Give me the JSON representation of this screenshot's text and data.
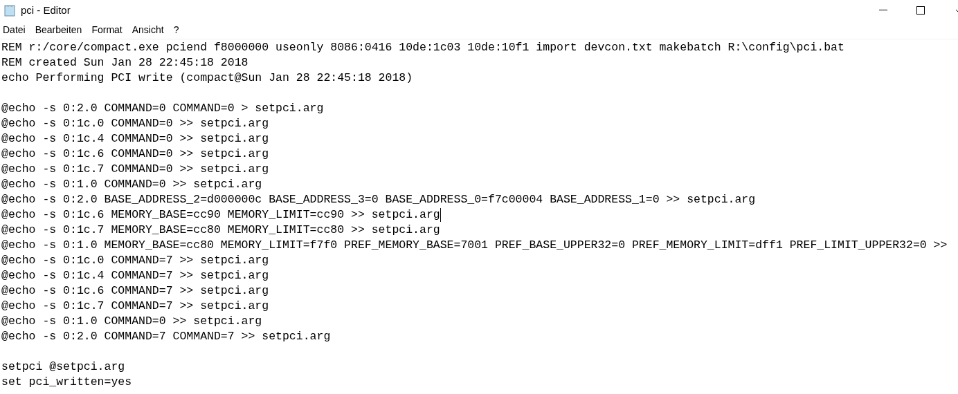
{
  "window": {
    "title": "pci - Editor"
  },
  "menu": [
    "Datei",
    "Bearbeiten",
    "Format",
    "Ansicht",
    "?"
  ],
  "lines": [
    {
      "kind": "text",
      "text": "REM r:/core/compact.exe pciend f8000000 useonly 8086:0416 10de:1c03 10de:10f1 import devcon.txt makebatch R:\\config\\pci.bat",
      "caret": false
    },
    {
      "kind": "text",
      "text": "REM created Sun Jan 28 22:45:18 2018",
      "caret": false
    },
    {
      "kind": "text",
      "text": "echo Performing PCI write (compact@Sun Jan 28 22:45:18 2018)",
      "caret": false
    },
    {
      "kind": "blank",
      "caret": false
    },
    {
      "kind": "text",
      "text": "@echo -s 0:2.0 COMMAND=0 COMMAND=0 > setpci.arg",
      "caret": false
    },
    {
      "kind": "text",
      "text": "@echo -s 0:1c.0 COMMAND=0 >> setpci.arg",
      "caret": false
    },
    {
      "kind": "text",
      "text": "@echo -s 0:1c.4 COMMAND=0 >> setpci.arg",
      "caret": false
    },
    {
      "kind": "text",
      "text": "@echo -s 0:1c.6 COMMAND=0 >> setpci.arg",
      "caret": false
    },
    {
      "kind": "text",
      "text": "@echo -s 0:1c.7 COMMAND=0 >> setpci.arg",
      "caret": false
    },
    {
      "kind": "text",
      "text": "@echo -s 0:1.0 COMMAND=0 >> setpci.arg",
      "caret": false
    },
    {
      "kind": "text",
      "text": "@echo -s 0:2.0 BASE_ADDRESS_2=d000000c BASE_ADDRESS_3=0 BASE_ADDRESS_0=f7c00004 BASE_ADDRESS_1=0 >> setpci.arg",
      "caret": false
    },
    {
      "kind": "text",
      "text": "@echo -s 0:1c.6 MEMORY_BASE=cc90 MEMORY_LIMIT=cc90 >> setpci.arg",
      "caret": true
    },
    {
      "kind": "text",
      "text": "@echo -s 0:1c.7 MEMORY_BASE=cc80 MEMORY_LIMIT=cc80 >> setpci.arg",
      "caret": false
    },
    {
      "kind": "text",
      "text": "@echo -s 0:1.0 MEMORY_BASE=cc80 MEMORY_LIMIT=f7f0 PREF_MEMORY_BASE=7001 PREF_BASE_UPPER32=0 PREF_MEMORY_LIMIT=dff1 PREF_LIMIT_UPPER32=0 >>",
      "caret": false
    },
    {
      "kind": "text",
      "text": "@echo -s 0:1c.0 COMMAND=7 >> setpci.arg",
      "caret": false
    },
    {
      "kind": "text",
      "text": "@echo -s 0:1c.4 COMMAND=7 >> setpci.arg",
      "caret": false
    },
    {
      "kind": "text",
      "text": "@echo -s 0:1c.6 COMMAND=7 >> setpci.arg",
      "caret": false
    },
    {
      "kind": "text",
      "text": "@echo -s 0:1c.7 COMMAND=7 >> setpci.arg",
      "caret": false
    },
    {
      "kind": "text",
      "text": "@echo -s 0:1.0 COMMAND=0 >> setpci.arg",
      "caret": false
    },
    {
      "kind": "text",
      "text": "@echo -s 0:2.0 COMMAND=7 COMMAND=7 >> setpci.arg",
      "caret": false
    },
    {
      "kind": "blank",
      "caret": false
    },
    {
      "kind": "text",
      "text": "setpci @setpci.arg",
      "caret": false
    },
    {
      "kind": "text",
      "text": "set pci_written=yes",
      "caret": false
    }
  ]
}
